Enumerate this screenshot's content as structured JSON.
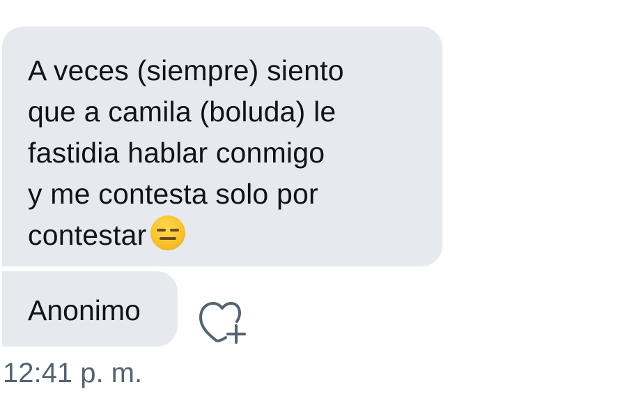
{
  "message": {
    "lines": [
      "A veces (siempre) siento",
      "que a camila (boluda) le",
      "fastidia hablar conmigo",
      "y me contesta solo por",
      "contestar"
    ],
    "emoji": "expressionless-face"
  },
  "sender": {
    "name": "Anonimo"
  },
  "actions": {
    "like_icon": "heart-plus-icon"
  },
  "timestamp": "12:41 p. m.",
  "colors": {
    "bubble_bg": "#e6eaee",
    "text": "#0f1419",
    "timestamp": "#536471",
    "icon_stroke": "#536471"
  }
}
